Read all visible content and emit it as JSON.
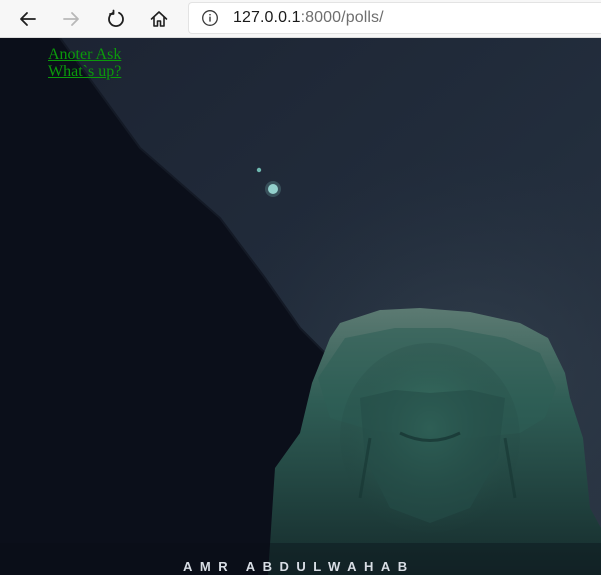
{
  "browser": {
    "back_icon": "back-arrow-icon",
    "forward_icon": "forward-arrow-icon",
    "reload_icon": "reload-icon",
    "home_icon": "home-icon",
    "info_icon": "info-icon",
    "url_host": "127.0.0.1",
    "url_rest": ":8000/polls/"
  },
  "page": {
    "links": [
      {
        "label": "Anoter Ask"
      },
      {
        "label": "What`s up?"
      }
    ],
    "background_credit": "AMR ABDULWAHAB",
    "link_color": "#0b9a0b"
  }
}
